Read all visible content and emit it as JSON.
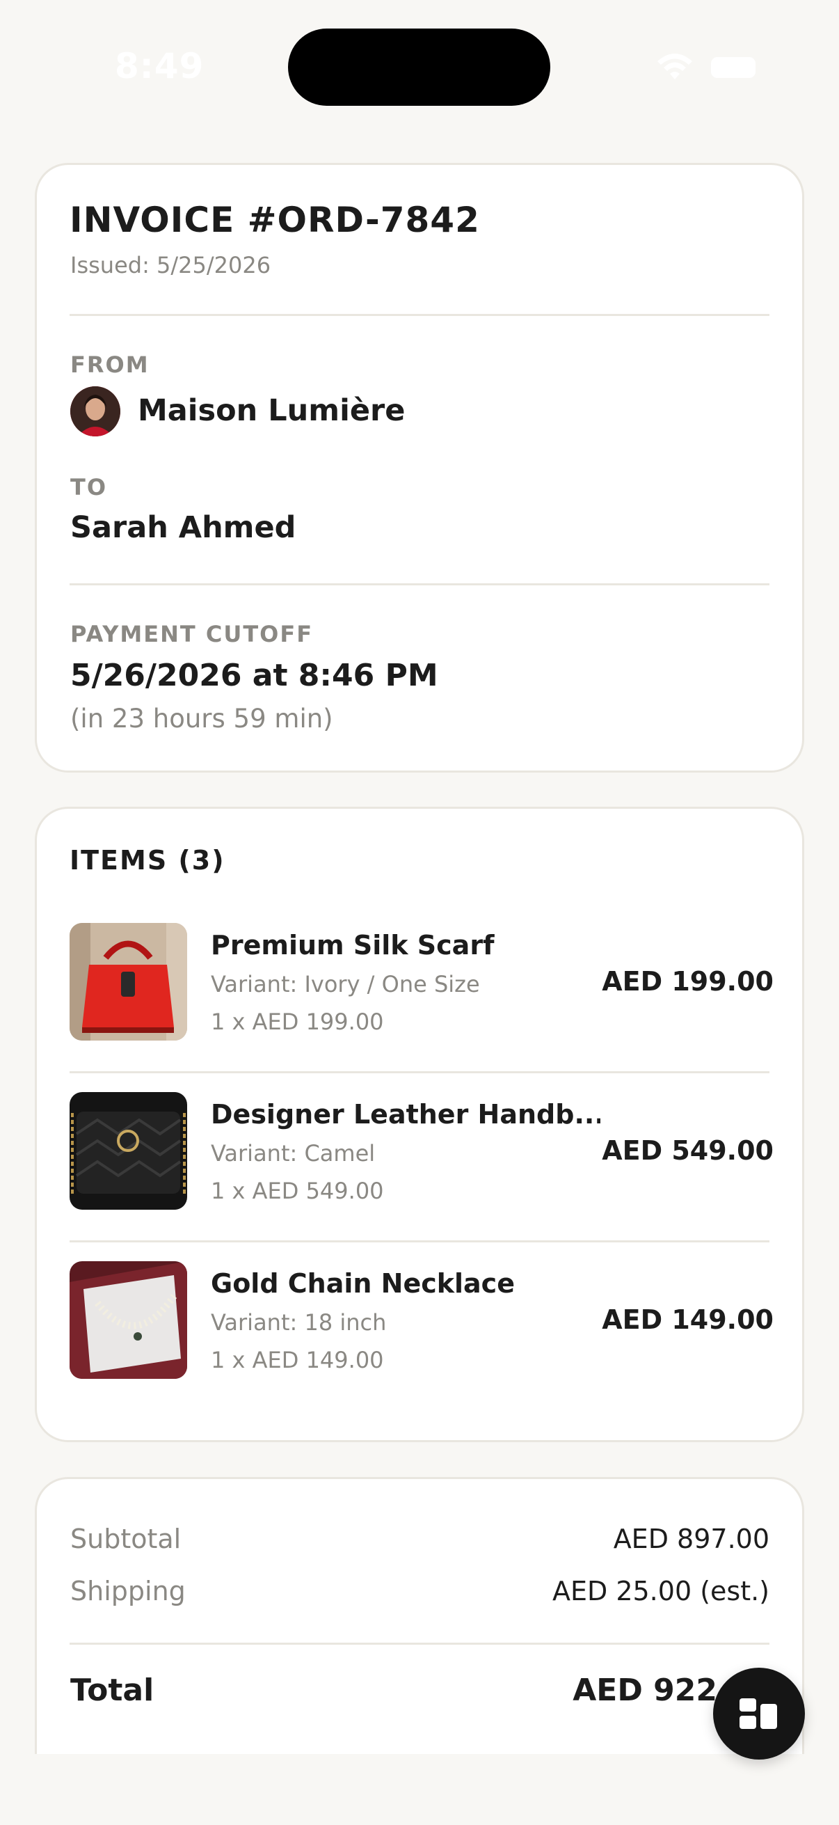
{
  "status_bar": {
    "time": "8:49"
  },
  "invoice": {
    "title": "INVOICE #ORD-7842",
    "issued": "Issued: 5/25/2026",
    "from_label": "FROM",
    "from_name": "Maison Lumière",
    "to_label": "TO",
    "to_name": "Sarah Ahmed",
    "cutoff_label": "PAYMENT CUTOFF",
    "cutoff_value": "5/26/2026 at 8:46 PM",
    "cutoff_remaining": "(in 23 hours 59 min)"
  },
  "items": {
    "title": "ITEMS (3)",
    "list": [
      {
        "name": "Premium Silk Scarf",
        "variant": "Variant: Ivory / One Size",
        "qty": "1 x AED 199.00",
        "price": "AED 199.00",
        "thumb": "red-handbag-image"
      },
      {
        "name": "Designer Leather Handb...",
        "variant": "Variant: Camel",
        "qty": "1 x AED 549.00",
        "price": "AED 549.00",
        "thumb": "black-quilted-bag-image"
      },
      {
        "name": "Gold Chain Necklace",
        "variant": "Variant: 18 inch",
        "qty": "1 x AED 149.00",
        "price": "AED 149.00",
        "thumb": "pearl-necklace-image"
      }
    ]
  },
  "summary": {
    "subtotal_label": "Subtotal",
    "subtotal_value": "AED 897.00",
    "shipping_label": "Shipping",
    "shipping_value": "AED 25.00 (est.)",
    "total_label": "Total",
    "total_value": "AED 922"
  },
  "fab": {
    "icon": "grid-icon"
  },
  "colors": {
    "background": "#f8f7f4",
    "card": "#ffffff",
    "border": "#e9e6df",
    "muted_text": "#8a8883",
    "primary_text": "#1c1c1c",
    "fab": "#151515"
  }
}
